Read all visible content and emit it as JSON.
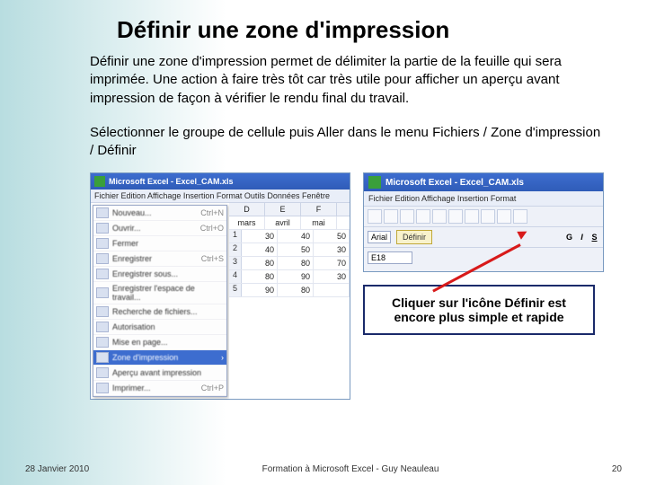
{
  "title": "Définir une zone d'impression",
  "paragraph1": "Définir une zone d'impression permet de délimiter la partie de la feuille qui sera imprimée. Une action à faire très tôt car très utile pour afficher un aperçu avant impression de façon à vérifier le rendu final du travail.",
  "paragraph2": "Sélectionner  le groupe de cellule puis Aller dans le menu Fichiers / Zone d'impression / Définir",
  "shot1": {
    "title": "Microsoft Excel - Excel_CAM.xls",
    "menubar": "Fichier  Edition  Affichage  Insertion  Format  Outils  Données  Fenêtre",
    "menu": [
      {
        "label": "Nouveau...",
        "sc": "Ctrl+N"
      },
      {
        "label": "Ouvrir...",
        "sc": "Ctrl+O"
      },
      {
        "label": "Fermer",
        "sc": ""
      },
      {
        "label": "Enregistrer",
        "sc": "Ctrl+S"
      },
      {
        "label": "Enregistrer sous...",
        "sc": ""
      },
      {
        "label": "Enregistrer l'espace de travail...",
        "sc": ""
      },
      {
        "label": "Recherche de fichiers...",
        "sc": ""
      },
      {
        "label": "Autorisation",
        "sc": ""
      },
      {
        "label": "Mise en page...",
        "sc": ""
      },
      {
        "label": "Zone d'impression",
        "sc": "›",
        "hl": true
      },
      {
        "label": "Aperçu avant impression",
        "sc": ""
      },
      {
        "label": "Imprimer...",
        "sc": "Ctrl+P"
      }
    ],
    "col_headers": [
      "D",
      "E",
      "F"
    ],
    "months": [
      "mars",
      "avril",
      "mai"
    ],
    "rows": [
      {
        "h": "1",
        "cells": [
          "30",
          "40",
          "50"
        ]
      },
      {
        "h": "2",
        "cells": [
          "40",
          "50",
          "30"
        ]
      },
      {
        "h": "3",
        "cells": [
          "80",
          "80",
          "70"
        ]
      },
      {
        "h": "4",
        "cells": [
          "80",
          "90",
          "30"
        ]
      },
      {
        "h": "5",
        "cells": [
          "90",
          "80",
          ""
        ]
      }
    ]
  },
  "shot2": {
    "title": "Microsoft Excel - Excel_CAM.xls",
    "menubar": "Fichier  Edition  Affichage  Insertion  Format",
    "font": "Arial",
    "cellref": "E18",
    "button": "Définir",
    "fmt_b": "G",
    "fmt_i": "I",
    "fmt_u": "S"
  },
  "callout": "Cliquer sur l'icône Définir est encore plus simple et rapide",
  "footer": {
    "date": "28 Janvier 2010",
    "center": "Formation à Microsoft Excel -  Guy Neauleau",
    "page": "20"
  }
}
